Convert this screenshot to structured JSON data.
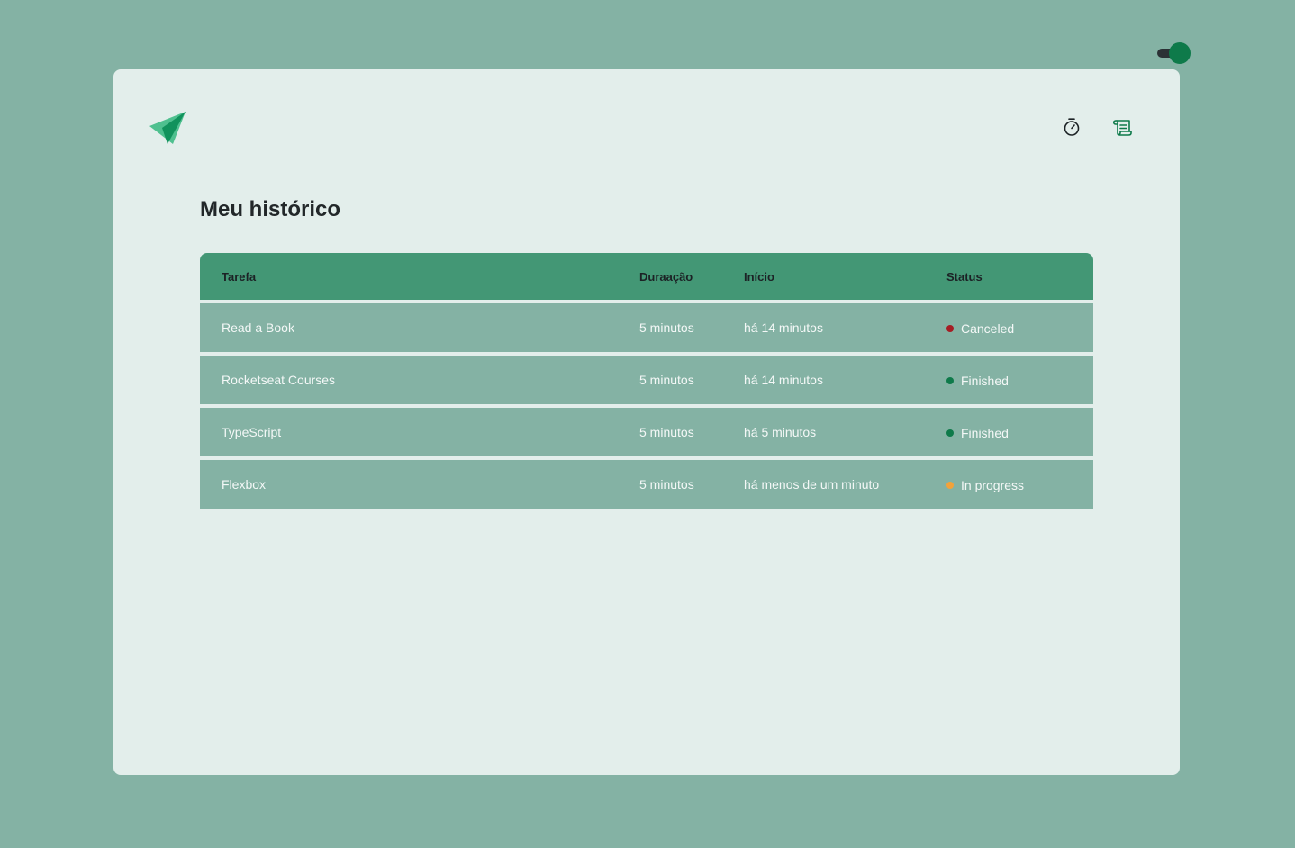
{
  "colors": {
    "page_bg": "#84b2a4",
    "card_bg": "#e3eeeb",
    "accent": "#0e7a4a",
    "logo_light": "#4fc08f",
    "logo_dark": "#11925c",
    "header_bg": "#439775",
    "row_bg": "#84b2a4",
    "status_canceled": "#a51d24",
    "status_finished": "#0e7a4a",
    "status_in_progress": "#f2a23a"
  },
  "toggle": {
    "state": "on"
  },
  "header": {
    "logo_icon": "paper-plane-logo",
    "nav": [
      {
        "icon": "timer-icon",
        "active": false
      },
      {
        "icon": "scroll-icon",
        "active": true
      }
    ]
  },
  "main": {
    "title": "Meu histórico",
    "table": {
      "columns": [
        "Tarefa",
        "Duraação",
        "Início",
        "Status"
      ],
      "rows": [
        {
          "task": "Read a Book",
          "duration": "5 minutos",
          "start": "há 14 minutos",
          "status": "Canceled",
          "status_color": "#a51d24"
        },
        {
          "task": "Rocketseat Courses",
          "duration": "5 minutos",
          "start": "há 14 minutos",
          "status": "Finished",
          "status_color": "#0e7a4a"
        },
        {
          "task": "TypeScript",
          "duration": "5 minutos",
          "start": "há 5 minutos",
          "status": "Finished",
          "status_color": "#0e7a4a"
        },
        {
          "task": "Flexbox",
          "duration": "5 minutos",
          "start": "há menos de um minuto",
          "status": "In progress",
          "status_color": "#f2a23a"
        }
      ]
    }
  }
}
